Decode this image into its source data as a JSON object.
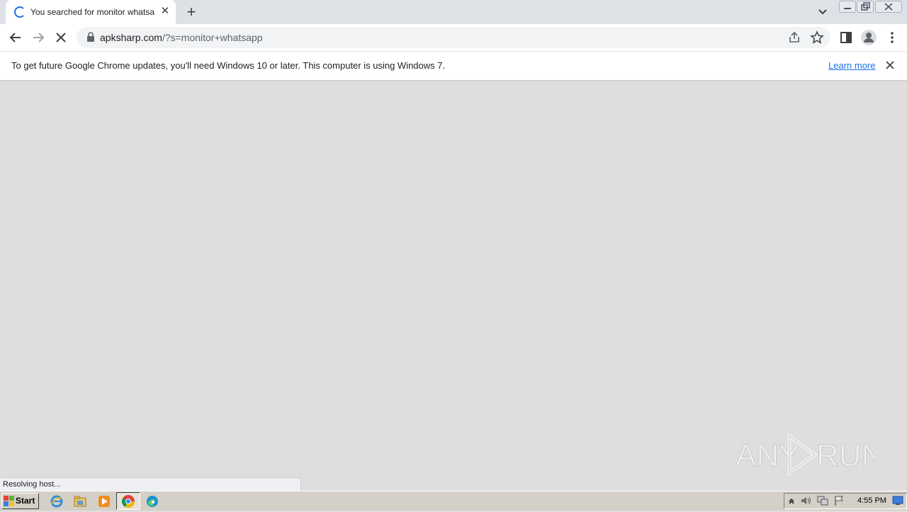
{
  "browser": {
    "tab": {
      "title": "You searched for monitor whatsapp"
    },
    "address": {
      "domain": "apksharp.com",
      "path": "/?s=monitor+whatsapp"
    }
  },
  "infobar": {
    "message": "To get future Google Chrome updates, you'll need Windows 10 or later. This computer is using Windows 7.",
    "link_label": "Learn more"
  },
  "status": {
    "text": "Resolving host..."
  },
  "watermark": {
    "text": "ANY RUN"
  },
  "taskbar": {
    "start_label": "Start",
    "clock": "4:55 PM"
  },
  "colors": {
    "accent": "#1a73e8",
    "page_bg": "#dedede"
  }
}
